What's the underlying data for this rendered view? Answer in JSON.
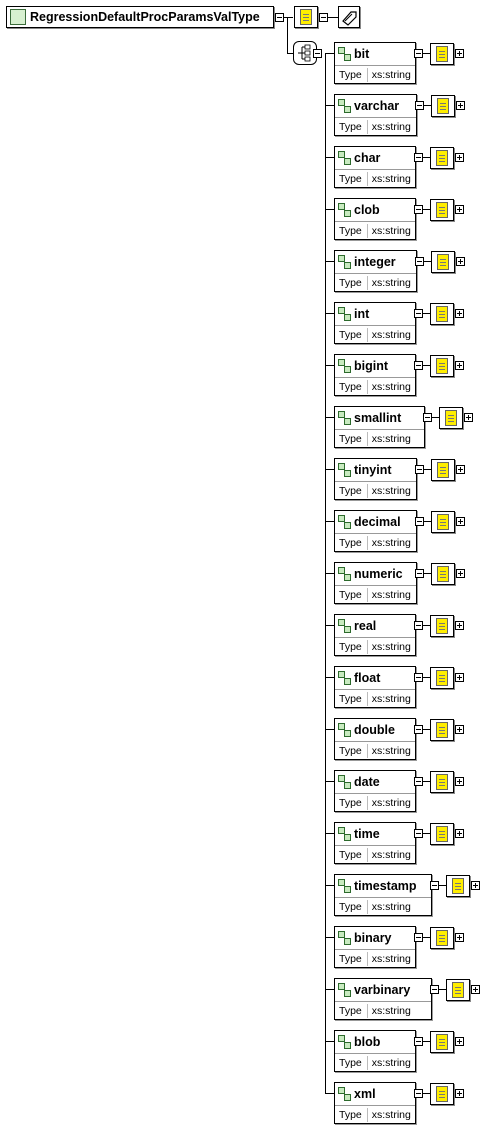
{
  "root": {
    "name": "RegressionDefaultProcParamsValType",
    "icon": "complex-type-icon"
  },
  "type_label": "Type",
  "elements": [
    {
      "name": "bit",
      "type": "xs:string"
    },
    {
      "name": "varchar",
      "type": "xs:string"
    },
    {
      "name": "char",
      "type": "xs:string"
    },
    {
      "name": "clob",
      "type": "xs:string"
    },
    {
      "name": "integer",
      "type": "xs:string"
    },
    {
      "name": "int",
      "type": "xs:string"
    },
    {
      "name": "bigint",
      "type": "xs:string"
    },
    {
      "name": "smallint",
      "type": "xs:string"
    },
    {
      "name": "tinyint",
      "type": "xs:string"
    },
    {
      "name": "decimal",
      "type": "xs:string"
    },
    {
      "name": "numeric",
      "type": "xs:string"
    },
    {
      "name": "real",
      "type": "xs:string"
    },
    {
      "name": "float",
      "type": "xs:string"
    },
    {
      "name": "double",
      "type": "xs:string"
    },
    {
      "name": "date",
      "type": "xs:string"
    },
    {
      "name": "time",
      "type": "xs:string"
    },
    {
      "name": "timestamp",
      "type": "xs:string"
    },
    {
      "name": "binary",
      "type": "xs:string"
    },
    {
      "name": "varbinary",
      "type": "xs:string"
    },
    {
      "name": "blob",
      "type": "xs:string"
    },
    {
      "name": "xml",
      "type": "xs:string"
    }
  ],
  "colors": {
    "note": "#ffee00",
    "type_icon": "#d7f0d0",
    "element_icon": "#c8eac0"
  }
}
